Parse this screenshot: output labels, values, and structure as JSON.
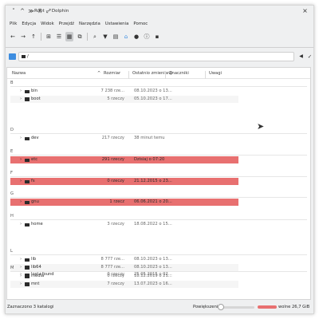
{
  "window": {
    "title": "Root — Dolphin",
    "title_buttons": [
      "˅",
      "^",
      "≫",
      "⊼",
      "⤢"
    ],
    "close_glyph": "×"
  },
  "menu": [
    "Plik",
    "Edycja",
    "Widok",
    "Przejdź",
    "Narzędzia",
    "Ustawienia",
    "Pomoc"
  ],
  "toolbar": {
    "back": "←",
    "forward": "→",
    "up": "↑",
    "view_icons": "⊞",
    "view_compact": "☰",
    "view_details": "▦",
    "split": "⧉",
    "search": "⌕",
    "filter": "▼",
    "preview": "▤",
    "terminal": "⌂",
    "new_folder": "●",
    "info": "ⓘ",
    "panel": "▪"
  },
  "location": {
    "path": "/",
    "go_glyph": "◀",
    "ok_glyph": "✓"
  },
  "columns": {
    "name": "Nazwa",
    "size": "Rozmiar",
    "modified": "Ostatnio zmieniany",
    "tags": "Znaczniki",
    "comments": "Uwagi"
  },
  "groups": [
    {
      "letter": "B",
      "rows": [
        {
          "name": "bin",
          "size": "7 238 rze...",
          "mod": "08.10.2023 o 13...",
          "selected": false
        },
        {
          "name": "boot",
          "size": "5 rzeczy",
          "mod": "05.10.2023 o 17...",
          "selected": false
        }
      ]
    },
    {
      "letter": "D",
      "rows": [
        {
          "name": "dev",
          "size": "217 rzeczy",
          "mod": "38 minut temu",
          "selected": false
        }
      ]
    },
    {
      "letter": "E",
      "rows": [
        {
          "name": "etc",
          "size": "291 rzeczy",
          "mod": "Dzisiaj o 07:20",
          "selected": true
        }
      ]
    },
    {
      "letter": "F",
      "rows": [
        {
          "name": "fs",
          "size": "0 rzeczy",
          "mod": "21.12.2015 o 23...",
          "selected": true
        }
      ]
    },
    {
      "letter": "G",
      "rows": [
        {
          "name": "gnu",
          "size": "1 rzecz",
          "mod": "06.06.2021 o 20...",
          "selected": true
        }
      ]
    },
    {
      "letter": "H",
      "rows": [
        {
          "name": "home",
          "size": "3 rzeczy",
          "mod": "18.08.2022 o 15...",
          "selected": false
        }
      ]
    },
    {
      "letter": "L",
      "rows": [
        {
          "name": "lib",
          "size": "8 777 rze...",
          "mod": "08.10.2023 o 13...",
          "selected": false
        },
        {
          "name": "lib64",
          "size": "8 777 rze...",
          "mod": "08.10.2023 o 13...",
          "selected": false
        },
        {
          "name": "lost+found",
          "size": "0 rzeczy",
          "mod": "25.05.2015 o 02...",
          "selected": false
        }
      ]
    },
    {
      "letter": "M",
      "rows": [
        {
          "name": "media",
          "size": "0 rzeczy",
          "mod": "18.12.2019 o 21...",
          "selected": false
        },
        {
          "name": "mnt",
          "size": "7 rzeczy",
          "mod": "13.07.2023 o 16...",
          "selected": false
        }
      ]
    }
  ],
  "status": {
    "selection": "Zaznaczono 3 katalogi",
    "zoom_label": "Powiększenie:",
    "free_space": "wolne 26,7 GiB"
  },
  "colors": {
    "selection": "#e87070",
    "accent": "#3d8de0"
  }
}
